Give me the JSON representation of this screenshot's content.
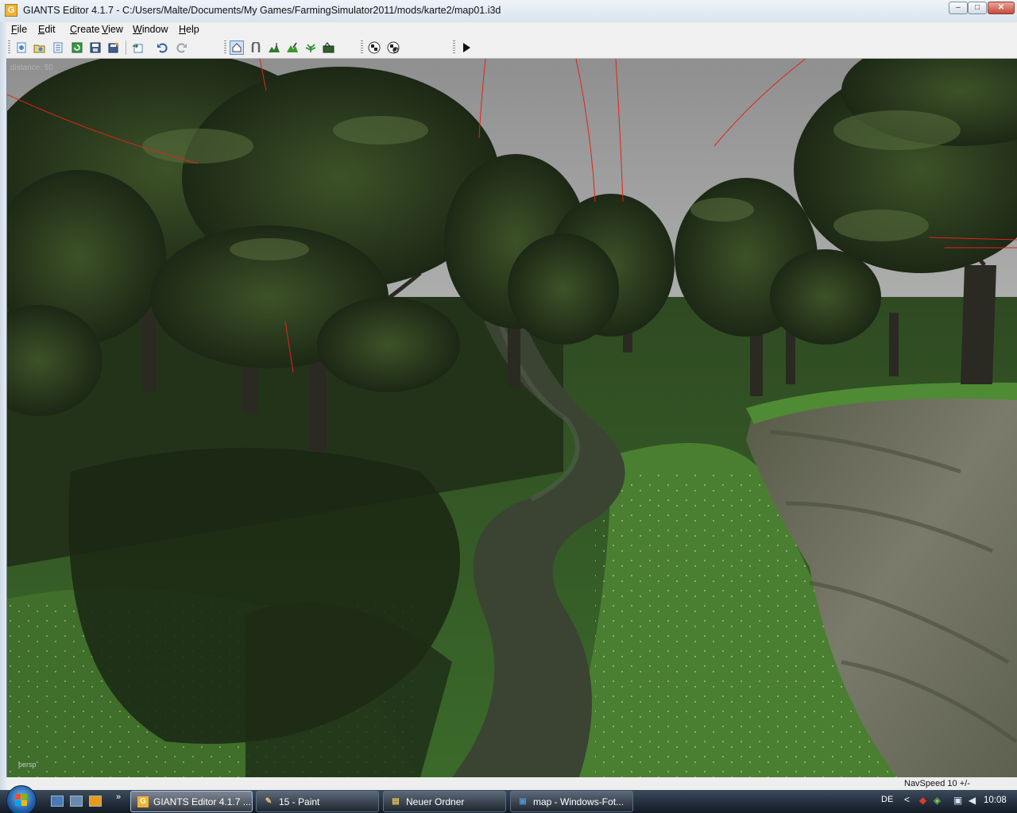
{
  "window": {
    "title": "GIANTS Editor 4.1.7 - C:/Users/Malte/Documents/My Games/FarmingSimulator2011/mods/karte2/map01.i3d",
    "icon_letter": "G",
    "controls": {
      "minimize": "–",
      "maximize": "□",
      "close": "✕"
    }
  },
  "menu": {
    "items": [
      "File",
      "Edit",
      "Create",
      "View",
      "Window",
      "Help"
    ]
  },
  "toolbar": {
    "icons": [
      "new-scene-icon",
      "open-scene-icon",
      "list-icon",
      "refresh-icon",
      "save-icon",
      "save-as-icon",
      "import-icon",
      "undo-icon",
      "redo-icon",
      "select-tool-icon",
      "move-tool-icon",
      "terrain-sculpt-icon",
      "terrain-paint-icon",
      "foliage-paint-icon",
      "terrain-detail-icon",
      "checker-render-icon",
      "checker-target-icon",
      "play-icon"
    ]
  },
  "viewport": {
    "distance_label": "distance: 50",
    "camera_label": "persp"
  },
  "status": {
    "navspeed": "NavSpeed 10 +/-"
  },
  "taskbar": {
    "tasks": [
      {
        "label": "GIANTS Editor 4.1.7 ...",
        "icon": "G",
        "icon_color": "#f2b233",
        "active": true
      },
      {
        "label": "15 - Paint",
        "icon": "✎",
        "icon_color": "#e8c77a",
        "active": false
      },
      {
        "label": "Neuer Ordner",
        "icon": "▤",
        "icon_color": "#e6c25a",
        "active": false
      },
      {
        "label": "map - Windows-Fot...",
        "icon": "▣",
        "icon_color": "#4f8ed0",
        "active": false
      }
    ],
    "language": "DE",
    "tray_arrow": "<",
    "clock": "10:08"
  },
  "colors": {
    "sky": "#9c9c9c",
    "foliage_dark": "#1e2a17",
    "grass": "#3e6a2a",
    "rock": "#6b6c5e",
    "selection_line": "#e2231a"
  }
}
